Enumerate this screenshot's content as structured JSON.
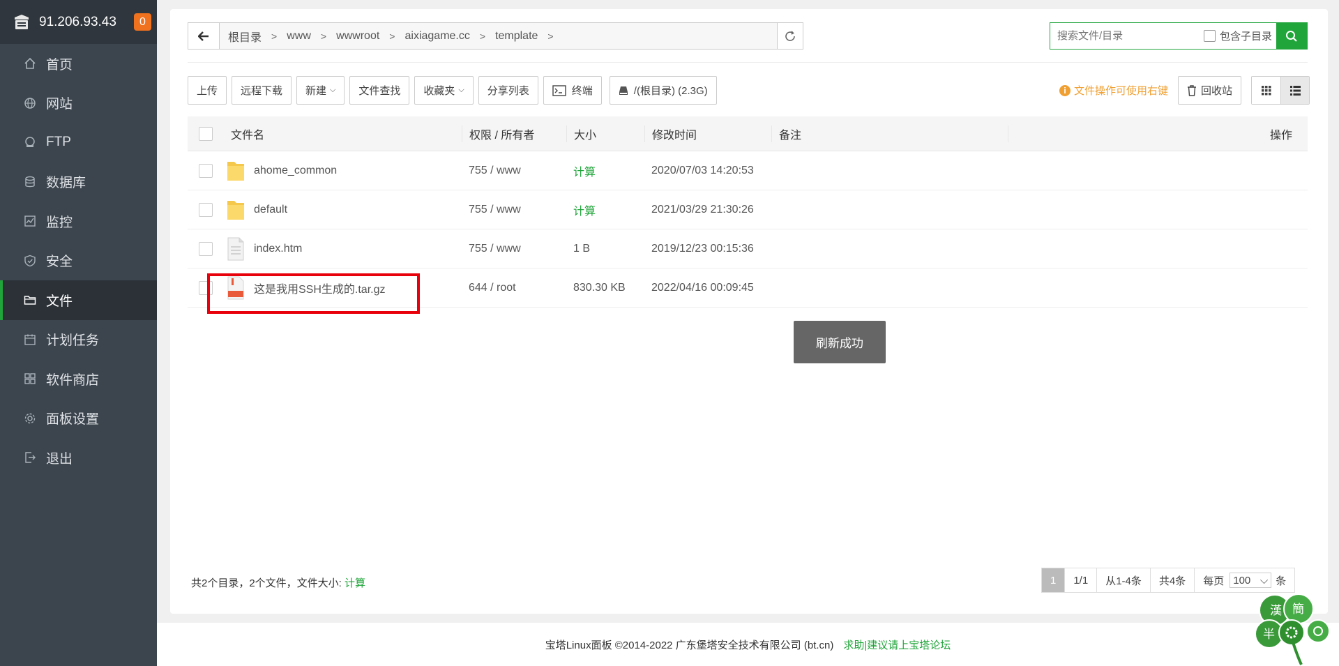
{
  "sidebar": {
    "ip": "91.206.93.43",
    "badge": "0",
    "items": [
      {
        "label": "首页",
        "icon": "home-icon"
      },
      {
        "label": "网站",
        "icon": "globe-icon"
      },
      {
        "label": "FTP",
        "icon": "ftp-icon"
      },
      {
        "label": "数据库",
        "icon": "database-icon"
      },
      {
        "label": "监控",
        "icon": "monitor-icon"
      },
      {
        "label": "安全",
        "icon": "shield-icon"
      },
      {
        "label": "文件",
        "icon": "folder-icon",
        "active": true
      },
      {
        "label": "计划任务",
        "icon": "calendar-icon"
      },
      {
        "label": "软件商店",
        "icon": "apps-icon"
      },
      {
        "label": "面板设置",
        "icon": "gear-icon"
      },
      {
        "label": "退出",
        "icon": "logout-icon"
      }
    ]
  },
  "path": {
    "crumbs": [
      "根目录",
      "www",
      "wwwroot",
      "aixiagame.cc",
      "template"
    ]
  },
  "search": {
    "placeholder": "搜索文件/目录",
    "subdir_label": "包含子目录"
  },
  "toolbar": {
    "upload": "上传",
    "remote_download": "远程下载",
    "new": "新建",
    "file_search": "文件查找",
    "favorites": "收藏夹",
    "share_list": "分享列表",
    "terminal": "终端",
    "disk": "/(根目录) (2.3G)",
    "tip": "文件操作可使用右键",
    "recycle": "回收站"
  },
  "table": {
    "headers": {
      "name": "文件名",
      "perm": "权限 / 所有者",
      "size": "大小",
      "time": "修改时间",
      "note": "备注",
      "op": "操作"
    },
    "rows": [
      {
        "name": "ahome_common",
        "type": "folder",
        "perm": "755 / www",
        "size": "计算",
        "time": "2020/07/03 14:20:53"
      },
      {
        "name": "default",
        "type": "folder",
        "perm": "755 / www",
        "size": "计算",
        "time": "2021/03/29 21:30:26"
      },
      {
        "name": "index.htm",
        "type": "file",
        "perm": "755 / www",
        "size": "1 B",
        "time": "2019/12/23 00:15:36"
      },
      {
        "name": "这是我用SSH生成的.tar.gz",
        "type": "archive",
        "perm": "644 / root",
        "size": "830.30 KB",
        "time": "2022/04/16 00:09:45"
      }
    ]
  },
  "toast": "刷新成功",
  "summary": {
    "text": "共2个目录，2个文件，文件大小: ",
    "calc": "计算"
  },
  "pager": {
    "current": "1",
    "pages": "1/1",
    "range": "从1-4条",
    "total": "共4条",
    "per_page_label": "每页",
    "per_page": "100",
    "unit": "条"
  },
  "footer": {
    "copyright": "宝塔Linux面板 ©2014-2022 广东堡塔安全技术有限公司 (bt.cn)",
    "help": "求助|建议请上宝塔论坛"
  },
  "widget": {
    "chars": [
      "漢",
      "簡",
      "半"
    ]
  },
  "colors": {
    "accent": "#20a53a",
    "sidebar": "#3c444d",
    "badge": "#f0711e",
    "highlight": "#e8000b",
    "tip": "#f0a032"
  }
}
